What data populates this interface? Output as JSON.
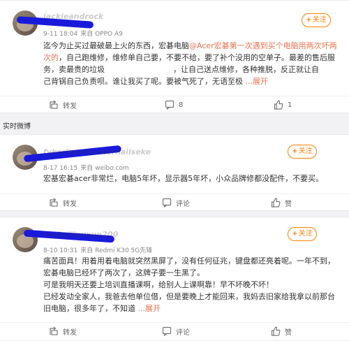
{
  "section_label": "实时微博",
  "follow_label": "关注",
  "follow_plus": "+",
  "posts": [
    {
      "username": "jackieandrock",
      "time": "9-11 18:04",
      "source": "来自 OPPO A9",
      "text_lines": [
        [
          "迄今为止买过最破最上火的东西，宏碁电脑",
          "@Acer宏碁第一次遇到买个电脑用两次坏两"
        ],
        [
          "次的",
          "，自己跑维修，维修单自己要，不要不给，要了补个没用的空单子。最差的售后服务，卖最贵的垃圾",
          "，让自己送点维修，各种推脱，反正就让自己背锅自己负责呗。谁让我买了呢。要被气死了，无语至极",
          "...",
          "展开"
        ]
      ],
      "line3_a": "务，卖最贵的垃圾",
      "line3_b": "，让自己送点维修，各种推脱，反正就让自",
      "line4": "己背锅自己负责呗。谁让我买了呢。要被气死了，无语至极",
      "more": " ...展开",
      "actions": {
        "repost": "转发",
        "comment": "8",
        "like": "1"
      }
    },
    {
      "username": "fykeriteamwaterhaiiseke",
      "time": "8-17 16:15",
      "source": "来自 weibo.com",
      "text": "宏基宏碁acer非常烂，电脑5年坏，显示器5年坏，小众品牌修都没配件，不要买。",
      "actions": {
        "repost": "转发",
        "comment": "评论",
        "like": "赞"
      }
    },
    {
      "username": "fyukajiinuxun200",
      "time": "8-10 10:31",
      "source": "来自 Redmi K30 5G先锋",
      "lines": [
        "痛苦面具！用着用着电脑就突然黑屏了，没有任何征兆，键盘都还亮着呢。一年不到，",
        "宏碁电脑已经坏了两次了，这牌子要一生黑了。",
        "可是我明天还要上培训直播课啊，给别人上课啊靠！早不坏晚不坏！",
        "已经发动全家人，我爸去他单位借，但是要晚上才能回来，我妈去旧家给我拿以前那台",
        "旧电脑，很多年了，不知道"
      ],
      "more": " ...展开",
      "actions": {
        "repost": "转发",
        "comment": "评论",
        "like": "赞"
      }
    }
  ],
  "post1_line1_plain": "迄今为止买过最破最上火的东西，宏碁电脑",
  "post1_line1_hl": "@Acer宏碁第一次遇到买个电脑用两次坏两",
  "post1_line2_hl": "次的",
  "post1_line2_plain": "，自己跑维修，维修单自己要，不要不给，要了补个没用的空单子。最差的售后服",
  "colors": {
    "accent": "#ff8200",
    "link": "#eb7350",
    "background": "#f2f2f5"
  },
  "icons": [
    "repost-icon",
    "comment-icon",
    "like-icon",
    "plus-icon"
  ]
}
